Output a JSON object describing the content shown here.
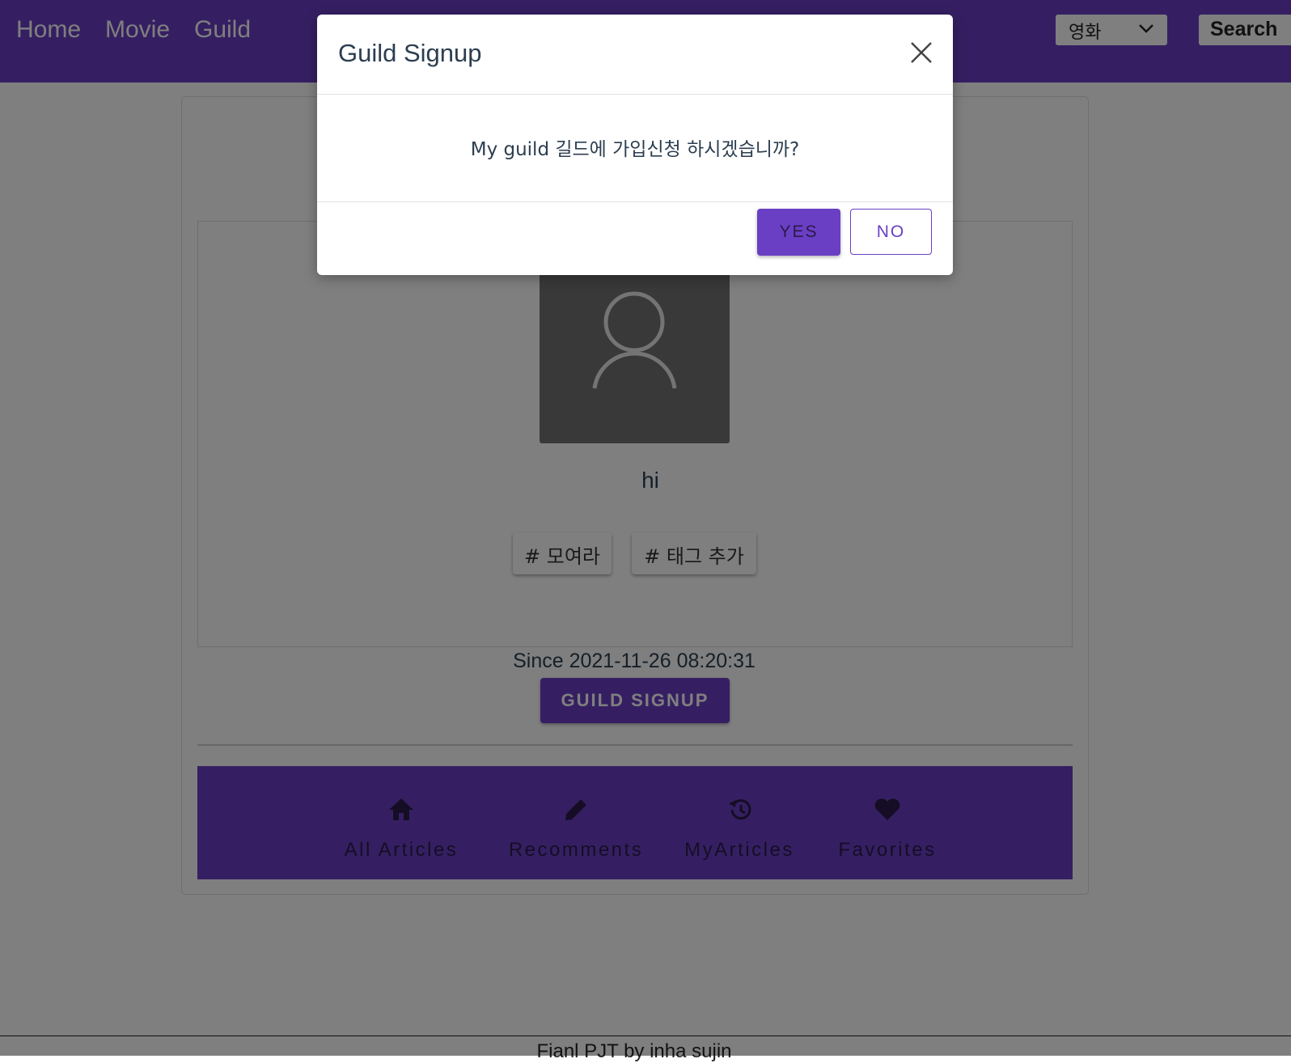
{
  "nav": {
    "links": [
      "Home",
      "Movie",
      "Guild"
    ],
    "select_value": "영화",
    "search_label": "Search"
  },
  "profile": {
    "name": "hi",
    "tags": [
      "# 모여라",
      "# 태그 추가"
    ],
    "since": "Since 2021-11-26 08:20:31",
    "signup_label": "GUILD SIGNUP"
  },
  "bottom_nav": {
    "items": [
      {
        "label": "All Articles",
        "icon": "home-icon"
      },
      {
        "label": "Recomments",
        "icon": "pencil-icon"
      },
      {
        "label": "MyArticles",
        "icon": "history-icon"
      },
      {
        "label": "Favorites",
        "icon": "heart-icon"
      }
    ]
  },
  "footer": {
    "text": "Fianl PJT by inha sujin"
  },
  "modal": {
    "title": "Guild Signup",
    "message": "My guild 길드에 가입신청 하시겠습니까?",
    "yes_label": "YES",
    "no_label": "NO"
  },
  "colors": {
    "primary": "#6a3fc4",
    "overlay": "rgba(0,0,0,0.5)",
    "avatar_bg": "#737373"
  }
}
